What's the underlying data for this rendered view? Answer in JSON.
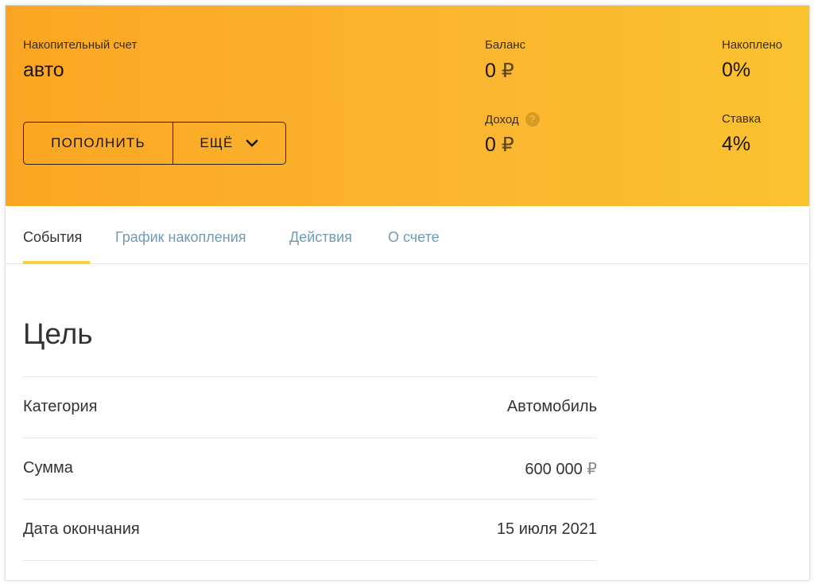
{
  "header": {
    "account_type": "Накопительный счет",
    "account_name": "авто",
    "buttons": {
      "topup": "ПОПОЛНИТЬ",
      "more": "ЕЩЁ"
    },
    "stats": {
      "balance": {
        "label": "Баланс",
        "value": "0",
        "currency": "₽"
      },
      "accumulated": {
        "label": "Накоплено",
        "value": "0%"
      },
      "income": {
        "label": "Доход",
        "value": "0",
        "currency": "₽",
        "help": "?"
      },
      "rate": {
        "label": "Ставка",
        "value": "4%"
      }
    },
    "colors": {
      "gradient_start": "#fba623",
      "gradient_end": "#fbc22f"
    }
  },
  "tabs": [
    {
      "label": "События",
      "active": true
    },
    {
      "label": "График накопления",
      "active": false
    },
    {
      "label": "Действия",
      "active": false
    },
    {
      "label": "О счете",
      "active": false
    }
  ],
  "goal": {
    "title": "Цель",
    "rows": [
      {
        "label": "Категория",
        "value": "Автомобиль"
      },
      {
        "label": "Сумма",
        "value": "600 000",
        "currency": "₽"
      },
      {
        "label": "Дата окончания",
        "value": "15 июля 2021"
      }
    ]
  },
  "icons": {
    "more_chevron": "chevron-down-icon",
    "income_help": "question-circle-icon"
  },
  "accent_color": "#f7d23a",
  "link_color": "#6e9bb5"
}
